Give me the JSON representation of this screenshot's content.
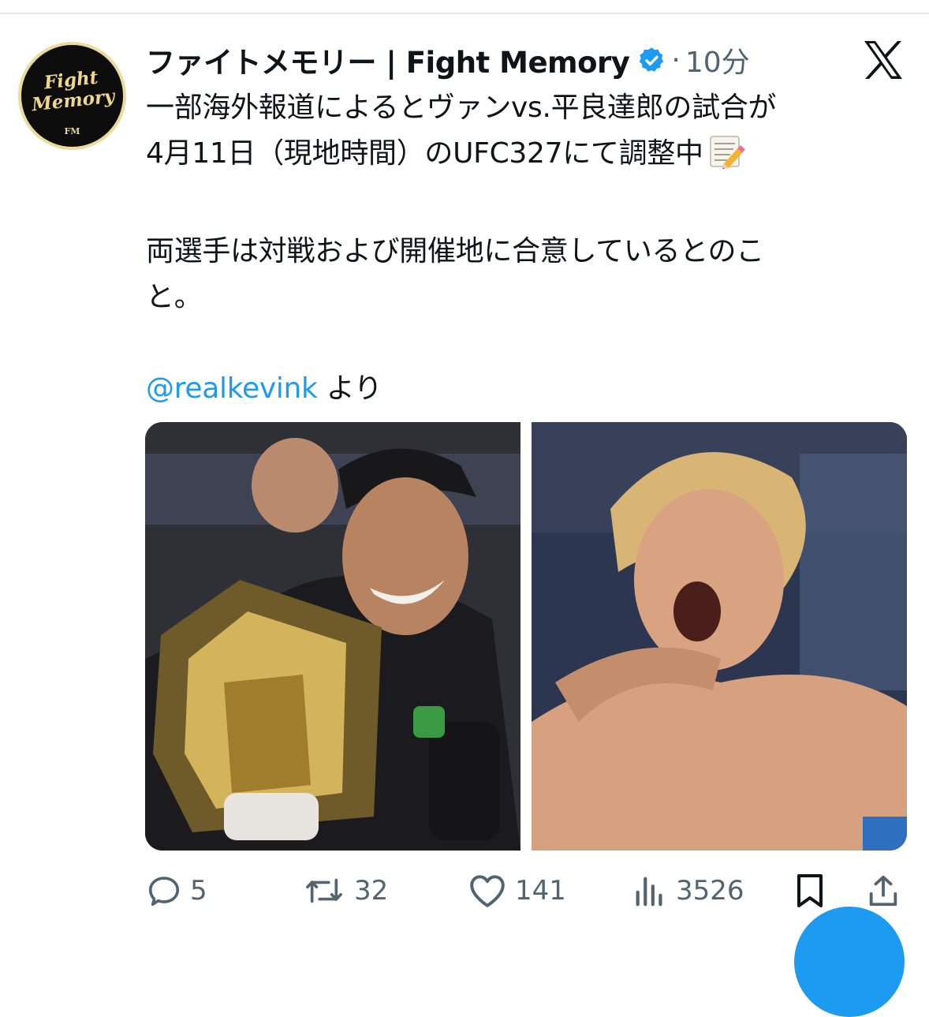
{
  "account": {
    "name": "ファイトメモリー | Fight Memory",
    "separator": "·",
    "time": "10分",
    "avatar_line1": "Fight",
    "avatar_line2": "Memory",
    "avatar_mark": "FM"
  },
  "tweet": {
    "line1": "一部海外報道によるとヴァンvs.平良達郎の試合が",
    "line2": "4月11日（現地時間）のUFC327にて調整中",
    "line3": "両選手は対戦および開催地に合意しているとのこ",
    "line4": "と。",
    "mention": "@realkevink",
    "mention_suffix": " より",
    "emoji": "memo-emoji"
  },
  "media": {
    "left_icon": "fighter-with-belt-photo",
    "right_icon": "fighter-shouting-photo"
  },
  "actions": {
    "replies": "5",
    "reposts": "32",
    "likes": "141",
    "views": "3526"
  },
  "colors": {
    "accent": "#1d9bf0",
    "text": "#0f1419",
    "secondary": "#536471",
    "avatar_gold": "#eed68a"
  }
}
